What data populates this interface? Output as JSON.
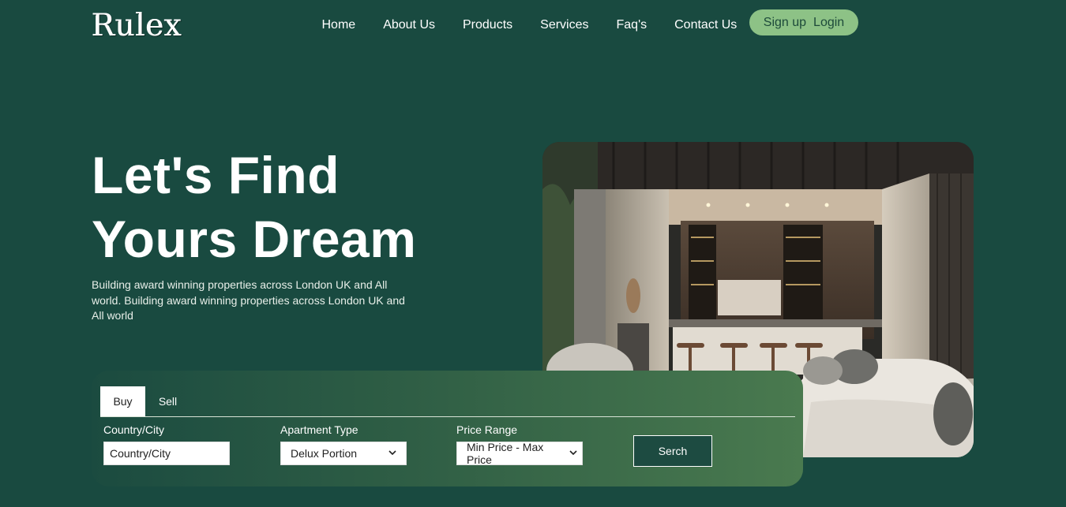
{
  "brand": {
    "logo_text": "Rulex"
  },
  "nav": {
    "items": [
      {
        "label": "Home"
      },
      {
        "label": "About Us"
      },
      {
        "label": "Products"
      },
      {
        "label": "Services"
      },
      {
        "label": "Faq's"
      },
      {
        "label": "Contact Us"
      }
    ],
    "signup_label": "Sign up",
    "login_label": "Login"
  },
  "hero": {
    "title_line1": "Let's Find",
    "title_line2": "Yours Dream",
    "description": "Building award winning properties across London UK and All world. Building award winning properties across London UK and All world"
  },
  "search": {
    "tabs": [
      {
        "label": "Buy",
        "active": true
      },
      {
        "label": "Sell",
        "active": false
      }
    ],
    "country": {
      "label": "Country/City",
      "placeholder": "Country/City",
      "value": ""
    },
    "apartment": {
      "label": "Apartment Type",
      "selected": "Delux Portion",
      "icon": "chevron-down-icon"
    },
    "price": {
      "label": "Price Range",
      "selected": "Min Price - Max Price",
      "icon": "chevron-down-icon"
    },
    "button_label": "Serch"
  },
  "colors": {
    "background": "#194a40",
    "accent_pill": "#8dc286",
    "panel_gradient_start": "#1b4b40",
    "panel_gradient_end": "#4a7a4f"
  }
}
